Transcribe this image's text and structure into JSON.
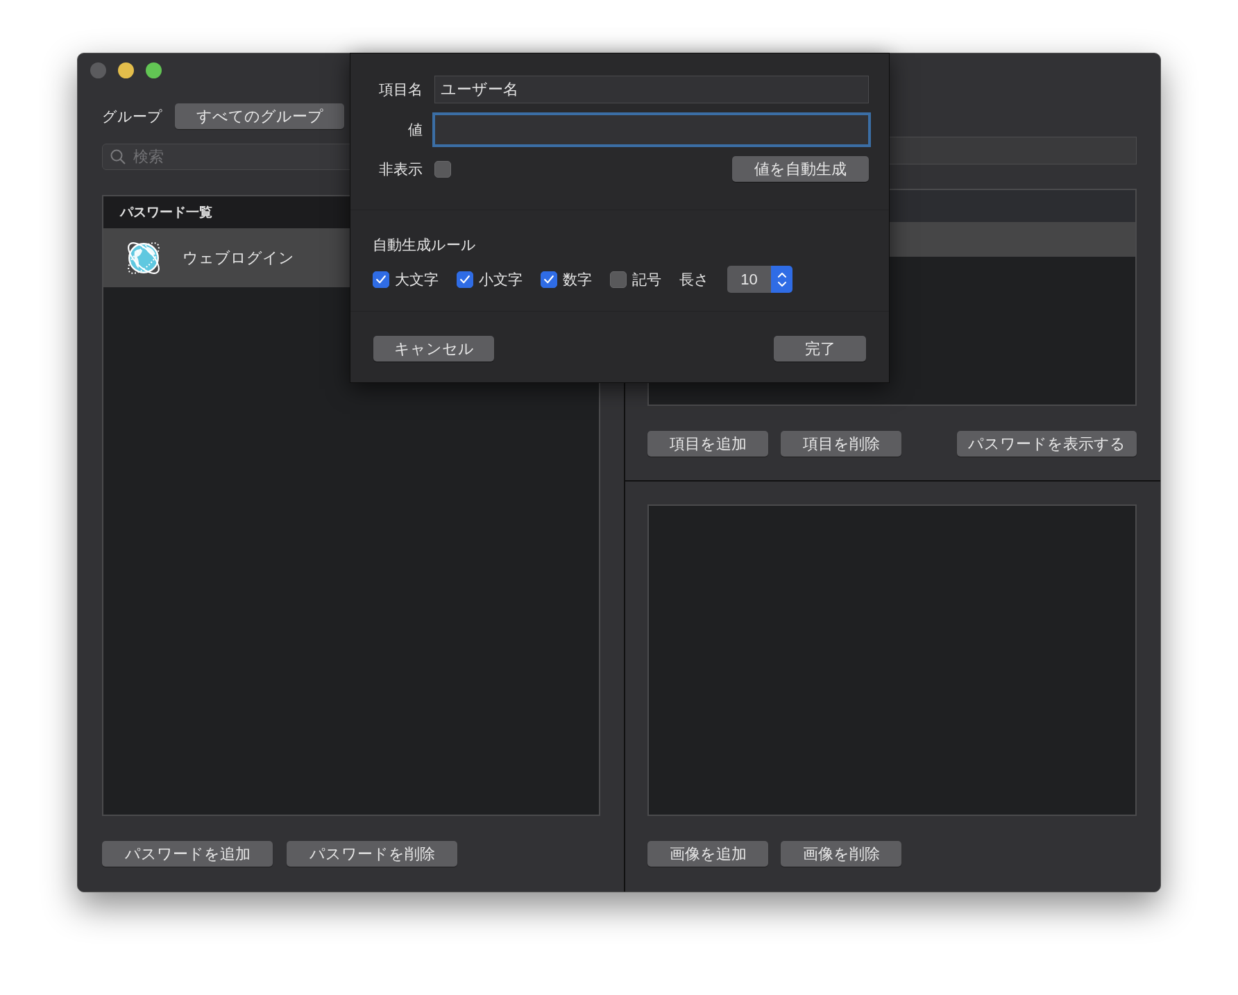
{
  "window_buttons": [
    {
      "kind": "close",
      "disabled": true
    },
    {
      "kind": "minimize",
      "disabled": false
    },
    {
      "kind": "zoom",
      "disabled": false
    }
  ],
  "group": {
    "label": "グループ",
    "value": "すべてのグループ"
  },
  "search": {
    "placeholder": "検索"
  },
  "password_list": {
    "header": "パスワード一覧",
    "rows": [
      {
        "title": "ウェブログイン",
        "selected": true
      }
    ]
  },
  "list_buttons": [
    "パスワードを追加",
    "パスワードを削除"
  ],
  "items_table": {
    "rows": [
      {
        "selected": true
      }
    ]
  },
  "item_buttons": [
    "項目を追加",
    "項目を削除",
    "パスワードを表示する"
  ],
  "image_buttons": [
    "画像を追加",
    "画像を削除"
  ],
  "sheet": {
    "name_label": "項目名",
    "name_value": "ユーザー名",
    "value_label": "値",
    "value_focused": true,
    "hidden_label": "非表示",
    "hidden_checked": false,
    "generate_button": "値を自動生成",
    "rules_title": "自動生成ルール",
    "rules": [
      {
        "label": "大文字",
        "checked": true
      },
      {
        "label": "小文字",
        "checked": true
      },
      {
        "label": "数字",
        "checked": true
      },
      {
        "label": "記号",
        "checked": false
      }
    ],
    "length_label": "長さ",
    "length": "10",
    "cancel_button": "キャンセル",
    "done_button": "完了"
  }
}
